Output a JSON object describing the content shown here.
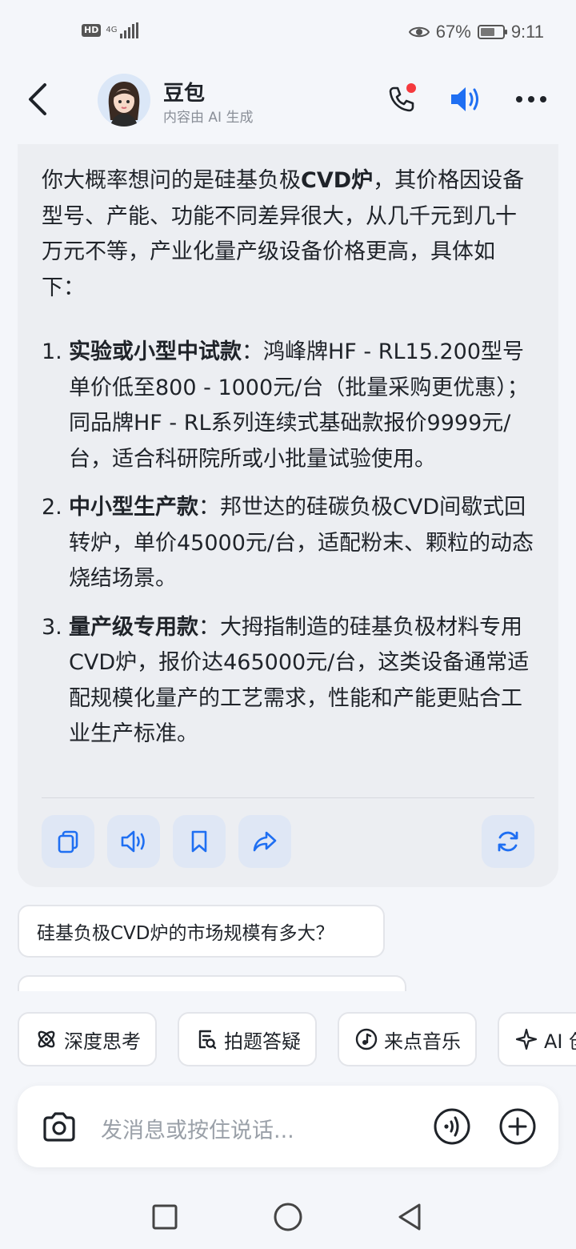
{
  "status_bar": {
    "hd": "HD",
    "network": "4G",
    "battery": "67%",
    "battery_level": 0.67,
    "time": "9:11"
  },
  "header": {
    "title": "豆包",
    "subtitle": "内容由 AI 生成",
    "icons": [
      "back-arrow-icon",
      "phone-icon",
      "speaker-icon",
      "more-icon"
    ],
    "accent": "#1f6ff2",
    "notification_dot_color": "#f5393d"
  },
  "message": {
    "intro_prefix": "你大概率想问的是硅基负极",
    "intro_bold": "CVD炉",
    "intro_suffix": "，其价格因设备型号、产能、功能不同差异很大，从几千元到几十万元不等，产业化量产级设备价格更高，具体如下：",
    "items": [
      {
        "num": "1.",
        "title": "实验或小型中试款",
        "text": "：鸿峰牌HF - RL15.200型号单价低至800 - 1000元/台（批量采购更优惠）；同品牌HF - RL系列连续式基础款报价9999元/台，适合科研院所或小批量试验使用。"
      },
      {
        "num": "2.",
        "title": "中小型生产款",
        "text": "：邦世达的硅碳负极CVD间歇式回转炉，单价45000元/台，适配粉末、颗粒的动态烧结场景。"
      },
      {
        "num": "3.",
        "title": "量产级专用款",
        "text": "：大拇指制造的硅基负极材料专用CVD炉，报价达465000元/台，这类设备通常适配规模化量产的工艺需求，性能和产能更贴合工业生产标准。"
      }
    ],
    "actions": [
      "copy-icon",
      "read-aloud-icon",
      "bookmark-icon",
      "share-icon",
      "regenerate-icon"
    ]
  },
  "suggestions": [
    "硅基负极CVD炉的市场规模有多大？",
    ""
  ],
  "chips": [
    {
      "icon": "atom-icon",
      "label": "深度思考"
    },
    {
      "icon": "photo-question-icon",
      "label": "拍题答疑"
    },
    {
      "icon": "music-icon",
      "label": "来点音乐"
    },
    {
      "icon": "sparkle-icon",
      "label": "AI 创"
    }
  ],
  "input": {
    "placeholder": "发消息或按住说话..."
  },
  "nav": [
    "recent-apps-icon",
    "home-icon",
    "back-icon"
  ]
}
